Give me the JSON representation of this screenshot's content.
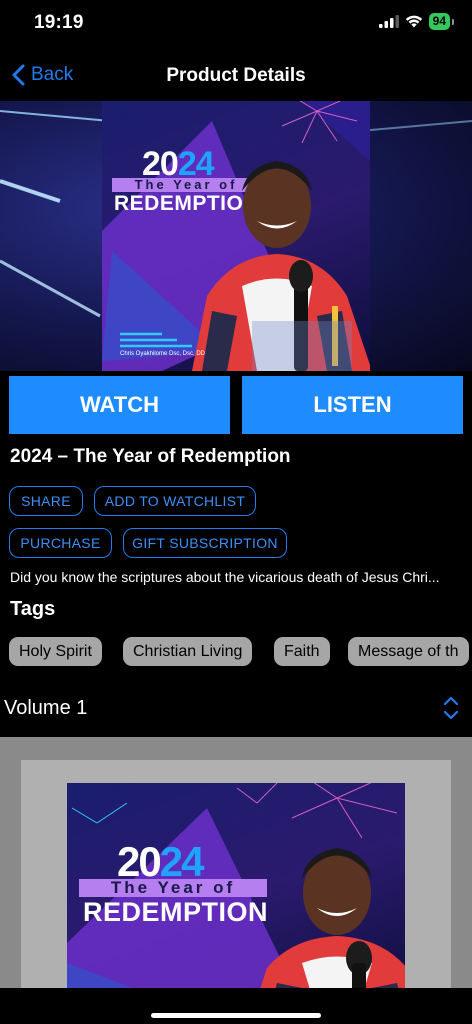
{
  "status": {
    "time": "19:19",
    "battery": "94"
  },
  "nav": {
    "back_label": "Back",
    "title": "Product Details"
  },
  "cover": {
    "year_black": "20",
    "year_blue": "24",
    "subtitle": "The Year of",
    "headline": "REDEMPTION",
    "author_caption": "Chris Oyakhilome Dsc, Dsc, DD"
  },
  "actions": {
    "watch": "WATCH",
    "listen": "LISTEN"
  },
  "product": {
    "title": "2024 – The Year of Redemption",
    "description": "Did you know the scriptures about the vicarious death of Jesus Chri..."
  },
  "buttons": {
    "share": "SHARE",
    "watchlist": "ADD TO WATCHLIST",
    "purchase": "PURCHASE",
    "gift": "GIFT SUBSCRIPTION"
  },
  "tags": {
    "heading": "Tags",
    "items": [
      "Holy Spirit",
      "Christian Living",
      "Faith",
      "Message of th"
    ]
  },
  "volume": {
    "label": "Volume 1"
  },
  "colors": {
    "accent": "#1e8bff",
    "link": "#1e7cf0",
    "tag_bg": "#a6a6a6",
    "battery": "#34c759"
  }
}
